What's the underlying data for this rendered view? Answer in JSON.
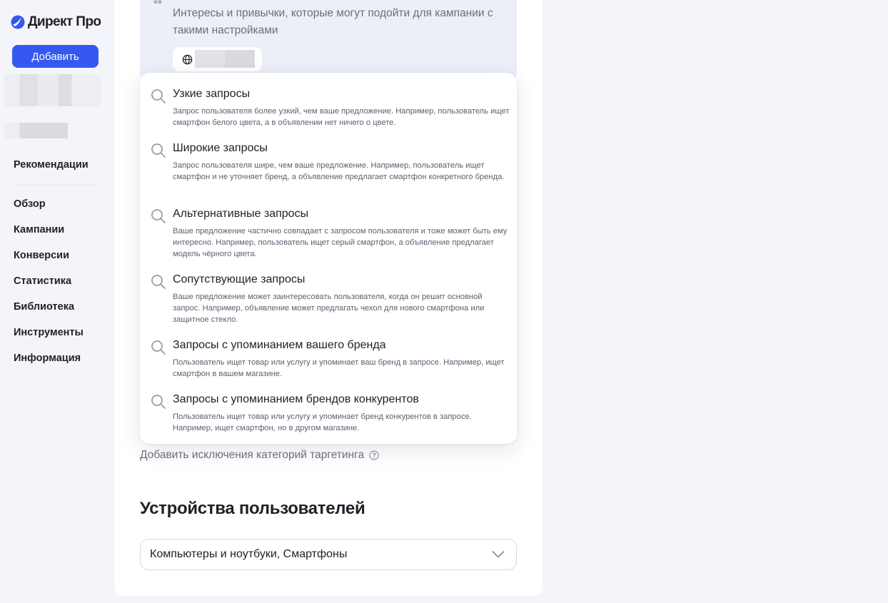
{
  "app": {
    "logo_text": "Директ Про"
  },
  "sidebar": {
    "add_button": "Добавить",
    "recommendations": "Рекомендации",
    "items": [
      "Обзор",
      "Кампании",
      "Конверсии",
      "Статистика",
      "Библиотека",
      "Инструменты",
      "Информация"
    ]
  },
  "interests": {
    "description": "Интересы и привычки, которые могут подойти для кампании с такими настройками",
    "chip_icon": "globe-icon"
  },
  "dropdown": {
    "options": [
      {
        "title": "Узкие запросы",
        "description": "Запрос пользователя более узкий, чем ваше предложение. Например, пользователь ищет смартфон белого цвета, а в объявлении нет ничего о цвете."
      },
      {
        "title": "Широкие запросы",
        "description": "Запрос пользователя шире, чем ваше предложение. Например, пользователь ищет смартфон и не уточняет бренд, а объявление предлагает смартфон конкретного бренда."
      },
      {
        "title": "Альтернативные запросы",
        "description": "Ваше предложение частично совпадает с запросом пользователя и тоже может быть ему интересно. Например, пользователь ищет серый смартфон, а объявление предлагает модель чёрного цвета."
      },
      {
        "title": "Сопутствующие запросы",
        "description": "Ваше предложение может заинтересовать пользователя, когда он решит основной запрос. Например, объявление может предлагать чехол для нового смартфона или защитное стекло."
      },
      {
        "title": "Запросы с упоминанием вашего бренда",
        "description": "Пользователь ищет товар или услугу и упоминает ваш бренд в запросе. Например, ищет смартфон в вашем магазине."
      },
      {
        "title": "Запросы с упоминанием брендов конкурентов",
        "description": "Пользователь ищет товар или услугу и упоминает бренд конкурентов в запросе. Например, ищет смартфон, но в другом магазине."
      }
    ]
  },
  "exclusions_link": "Добавить исключения категорий таргетинга",
  "devices": {
    "title": "Устройства пользователей",
    "value": "Компьютеры и ноутбуки, Смартфоны"
  },
  "colors": {
    "accent": "#3559f0",
    "page_bg": "#f4f5fa",
    "interest_bg": "#eceef8"
  }
}
